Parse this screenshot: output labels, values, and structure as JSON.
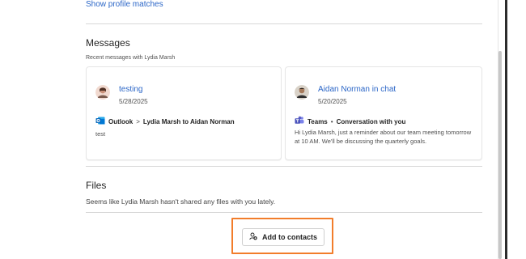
{
  "top_link": "Show profile matches",
  "messages": {
    "title": "Messages",
    "subtitle": "Recent messages with Lydia Marsh",
    "cards": [
      {
        "title": "testing",
        "date": "5/28/2025",
        "app": "Outlook",
        "separator": ">",
        "detail": "Lydia Marsh to Aidan Norman",
        "body": "test"
      },
      {
        "title": "Aidan Norman in chat",
        "date": "5/20/2025",
        "app": "Teams",
        "separator": "•",
        "detail": "Conversation with you",
        "body": "Hi Lydia Marsh, just a reminder about our team meeting tomorrow at 10 AM. We'll be discussing the quarterly goals."
      }
    ]
  },
  "files": {
    "title": "Files",
    "subtitle": "Seems like Lydia Marsh hasn't shared any files with you lately."
  },
  "add_contact_button": "Add to contacts",
  "colors": {
    "link": "#2b66c7",
    "highlight": "#f27d2b",
    "outlook": "#0f6cbd",
    "teams": "#5b5fc7"
  }
}
